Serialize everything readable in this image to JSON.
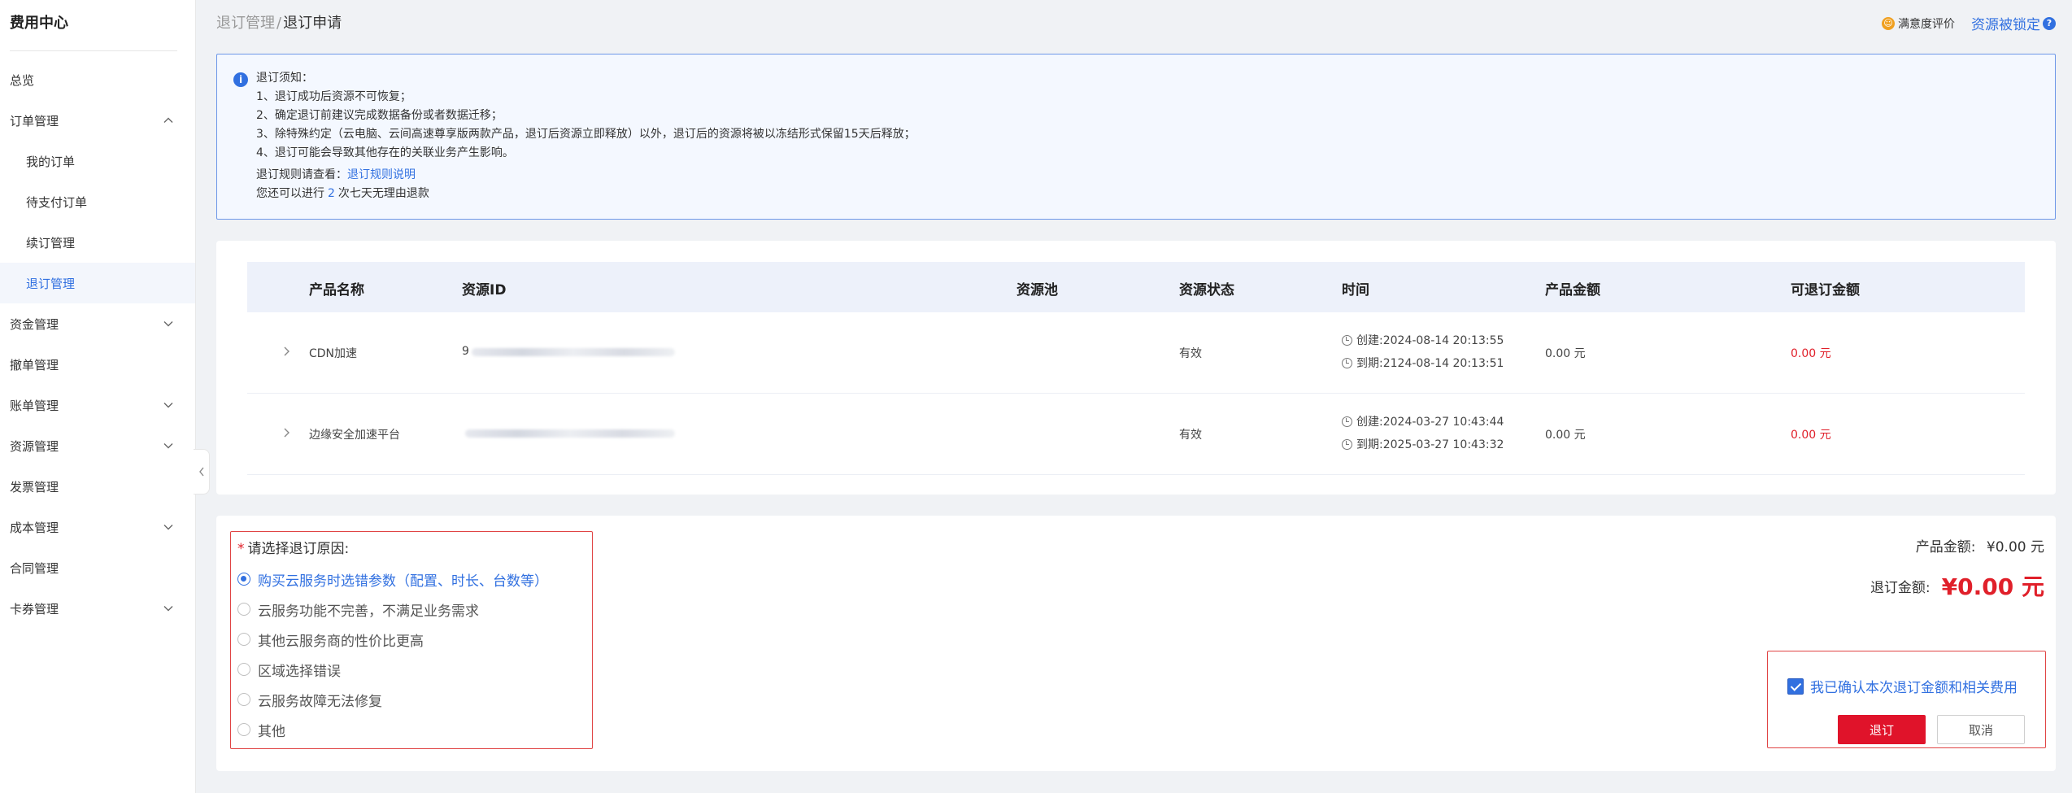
{
  "sidebar": {
    "title": "费用中心",
    "items": [
      {
        "label": "总览"
      },
      {
        "label": "订单管理"
      },
      {
        "label": "我的订单"
      },
      {
        "label": "待支付订单"
      },
      {
        "label": "续订管理"
      },
      {
        "label": "退订管理"
      },
      {
        "label": "资金管理"
      },
      {
        "label": "撤单管理"
      },
      {
        "label": "账单管理"
      },
      {
        "label": "资源管理"
      },
      {
        "label": "发票管理"
      },
      {
        "label": "成本管理"
      },
      {
        "label": "合同管理"
      },
      {
        "label": "卡券管理"
      }
    ]
  },
  "header": {
    "breadcrumb_parent": "退订管理",
    "breadcrumb_sep": "/",
    "breadcrumb_current": "退订申请",
    "satisfaction_label": "满意度评价",
    "resource_locked_label": "资源被锁定"
  },
  "notice": {
    "title": "退订须知：",
    "lines": [
      "1、退订成功后资源不可恢复；",
      "2、确定退订前建议完成数据备份或者数据迁移；",
      "3、除特殊约定（云电脑、云间高速尊享版两款产品，退订后资源立即释放）以外，退订后的资源将被以冻结形式保留15天后释放；",
      "4、退订可能会导致其他存在的关联业务产生影响。"
    ],
    "rule_prefix": "退订规则请查看：",
    "rule_link": "退订规则说明",
    "refund_prefix": "您还可以进行",
    "refund_count": "2",
    "refund_suffix": "次七天无理由退款"
  },
  "table": {
    "headers": [
      "产品名称",
      "资源ID",
      "资源池",
      "资源状态",
      "时间",
      "产品金额",
      "可退订金额"
    ],
    "rows": [
      {
        "product": "CDN加速",
        "id_prefix": "9",
        "status": "有效",
        "created": "创建:2024-08-14 20:13:55",
        "expires": "到期:2124-08-14 20:13:51",
        "amount": "0.00 元",
        "refundable": "0.00 元"
      },
      {
        "product": "边缘安全加速平台",
        "id_prefix": "",
        "status": "有效",
        "created": "创建:2024-03-27 10:43:44",
        "expires": "到期:2025-03-27 10:43:32",
        "amount": "0.00 元",
        "refundable": "0.00 元"
      }
    ]
  },
  "reason": {
    "required_mark": "*",
    "title": "请选择退订原因:",
    "options": [
      "购买云服务时选错参数（配置、时长、台数等）",
      "云服务功能不完善，不满足业务需求",
      "其他云服务商的性价比更高",
      "区域选择错误",
      "云服务故障无法修复",
      "其他"
    ],
    "selected_index": 0
  },
  "summary": {
    "product_amount_label": "产品金额:",
    "product_amount_value": "¥0.00 元",
    "refund_label": "退订金额:",
    "refund_value": "¥0.00 元",
    "confirm_label": "我已确认本次退订金额和相关费用",
    "confirm_checked": true,
    "submit_label": "退订",
    "cancel_label": "取消"
  },
  "colors": {
    "accent": "#3170e0",
    "danger": "#e0132a",
    "notice_bg": "#f4f8ff",
    "table_header_bg": "#edf1fa",
    "page_bg": "#f0f2f5"
  }
}
